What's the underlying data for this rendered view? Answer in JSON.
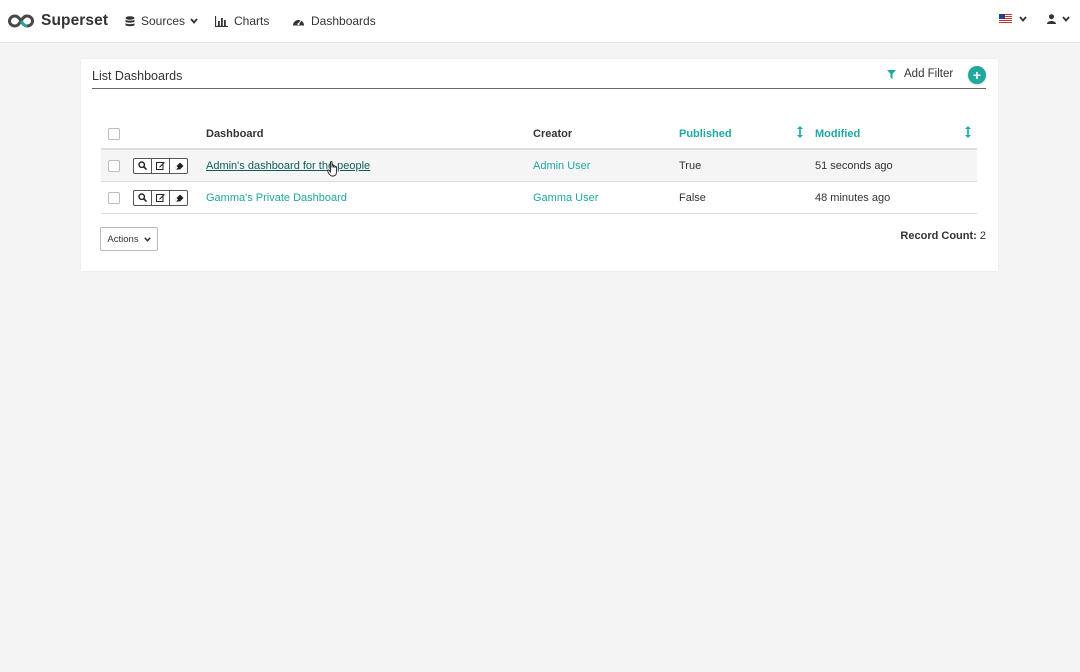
{
  "navbar": {
    "brand": "Superset",
    "menu": [
      {
        "label": "Sources",
        "icon": "database-icon",
        "dropdown": true
      },
      {
        "label": "Charts",
        "icon": "bar-chart-icon",
        "dropdown": false
      },
      {
        "label": "Dashboards",
        "icon": "dashboard-icon",
        "dropdown": false
      }
    ],
    "language_icon": "us-flag-icon",
    "user_icon": "user-icon"
  },
  "panel": {
    "title": "List Dashboards",
    "add_filter_label": "Add Filter",
    "add_button_glyph": "+"
  },
  "table": {
    "columns": {
      "dashboard": "Dashboard",
      "creator": "Creator",
      "published": "Published",
      "modified": "Modified"
    },
    "rows": [
      {
        "dashboard": "Admin's dashboard for the people",
        "creator": "Admin User",
        "published": "True",
        "modified": "51 seconds ago"
      },
      {
        "dashboard": "Gamma's Private Dashboard",
        "creator": "Gamma User",
        "published": "False",
        "modified": "48 minutes ago"
      }
    ]
  },
  "footer": {
    "actions_label": "Actions",
    "record_count_label": "Record Count:",
    "record_count_value": "2"
  },
  "colors": {
    "accent": "#20a7a0",
    "link_visited": "#0d5e5a",
    "background": "#f4f4f4"
  }
}
